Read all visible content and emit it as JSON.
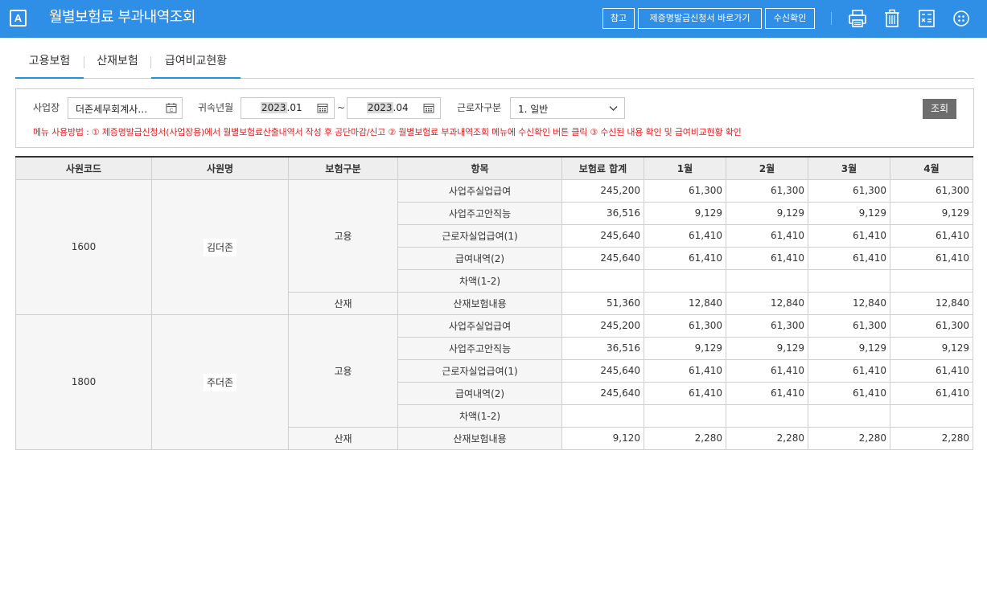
{
  "header": {
    "logo": "A",
    "title": "월별보험료 부과내역조회",
    "buttons": {
      "ref": "참고",
      "goto": "제증명발급신청서 바로가기",
      "confirm": "수신확인"
    },
    "icons": [
      "print-icon",
      "trash-icon",
      "calculator-icon",
      "more-icon"
    ]
  },
  "tabs": [
    {
      "label": "고용보험",
      "active": true
    },
    {
      "label": "산재보험",
      "active": false
    },
    {
      "label": "급여비교현황",
      "active": true
    }
  ],
  "search": {
    "workplace_label": "사업장",
    "workplace_value": "더존세무회계사…",
    "period_label": "귀속년월",
    "from_year": "2023",
    "from_month": ".01",
    "tilde": "~",
    "to_year": "2023",
    "to_month": ".04",
    "worker_type_label": "근로자구분",
    "worker_type_value": "1. 일반",
    "query_button": "조회",
    "usage": "메뉴 사용방법 : ① 제증명발급신청서(사업장용)에서 월별보험료산출내역서 작성 후 공단마감/신고 ② 월별보험료 부과내역조회 메뉴에 수신확인 버튼 클릭 ③ 수신된 내용 확인 및 급여비교현황 확인"
  },
  "table": {
    "headers": [
      "사원코드",
      "사원명",
      "보험구분",
      "항목",
      "보험료 합계",
      "1월",
      "2월",
      "3월",
      "4월"
    ],
    "employees": [
      {
        "code": "1600",
        "name": "김더존",
        "groups": [
          {
            "type": "고용",
            "rows": [
              {
                "item": "사업주실업급여",
                "values": [
                  "245,200",
                  "61,300",
                  "61,300",
                  "61,300",
                  "61,300"
                ]
              },
              {
                "item": "사업주고안직능",
                "values": [
                  "36,516",
                  "9,129",
                  "9,129",
                  "9,129",
                  "9,129"
                ]
              },
              {
                "item": "근로자실업급여(1)",
                "values": [
                  "245,640",
                  "61,410",
                  "61,410",
                  "61,410",
                  "61,410"
                ]
              },
              {
                "item": "급여내역(2)",
                "values": [
                  "245,640",
                  "61,410",
                  "61,410",
                  "61,410",
                  "61,410"
                ]
              },
              {
                "item": "차액(1-2)",
                "values": [
                  "",
                  "",
                  "",
                  "",
                  ""
                ]
              }
            ]
          },
          {
            "type": "산재",
            "rows": [
              {
                "item": "산재보험내용",
                "values": [
                  "51,360",
                  "12,840",
                  "12,840",
                  "12,840",
                  "12,840"
                ]
              }
            ]
          }
        ]
      },
      {
        "code": "1800",
        "name": "주더존",
        "groups": [
          {
            "type": "고용",
            "rows": [
              {
                "item": "사업주실업급여",
                "values": [
                  "245,200",
                  "61,300",
                  "61,300",
                  "61,300",
                  "61,300"
                ]
              },
              {
                "item": "사업주고안직능",
                "values": [
                  "36,516",
                  "9,129",
                  "9,129",
                  "9,129",
                  "9,129"
                ]
              },
              {
                "item": "근로자실업급여(1)",
                "values": [
                  "245,640",
                  "61,410",
                  "61,410",
                  "61,410",
                  "61,410"
                ]
              },
              {
                "item": "급여내역(2)",
                "values": [
                  "245,640",
                  "61,410",
                  "61,410",
                  "61,410",
                  "61,410"
                ]
              },
              {
                "item": "차액(1-2)",
                "values": [
                  "",
                  "",
                  "",
                  "",
                  ""
                ]
              }
            ]
          },
          {
            "type": "산재",
            "rows": [
              {
                "item": "산재보험내용",
                "values": [
                  "9,120",
                  "2,280",
                  "2,280",
                  "2,280",
                  "2,280"
                ]
              }
            ]
          }
        ]
      }
    ]
  }
}
